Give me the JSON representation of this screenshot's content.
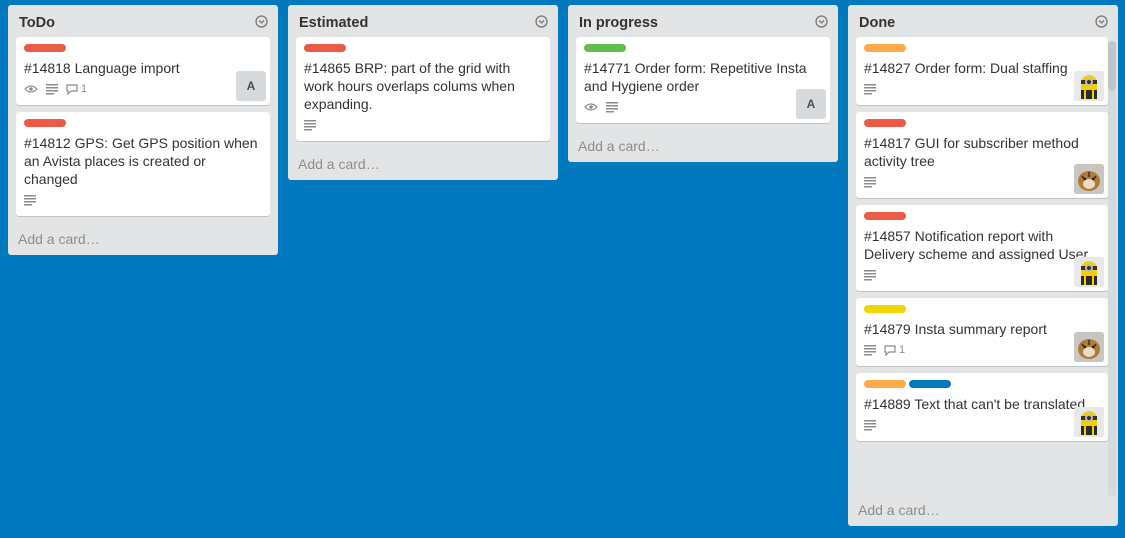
{
  "colors": {
    "background": "#0079bf",
    "red": "#eb5a46",
    "green": "#61bd4f",
    "orange": "#ffab4a",
    "yellow": "#f2d600",
    "blue": "#0079bf"
  },
  "lists": [
    {
      "title": "ToDo",
      "add_card": "Add a card…",
      "cards": [
        {
          "title": "#14818 Language import",
          "labels": [
            "red"
          ],
          "watch": true,
          "description": true,
          "comments": "1",
          "avatar": "A"
        },
        {
          "title": "#14812 GPS: Get GPS position when an Avista places is created or changed",
          "labels": [
            "red"
          ],
          "description": true
        }
      ]
    },
    {
      "title": "Estimated",
      "add_card": "Add a card…",
      "cards": [
        {
          "title": "#14865 BRP: part of the grid with work hours overlaps colums when expanding.",
          "labels": [
            "red"
          ],
          "description": true
        }
      ]
    },
    {
      "title": "In progress",
      "add_card": "Add a card…",
      "cards": [
        {
          "title": "#14771 Order form: Repetitive Insta and Hygiene order",
          "labels": [
            "green"
          ],
          "watch": true,
          "description": true,
          "avatar": "A"
        }
      ]
    },
    {
      "title": "Done",
      "add_card": "Add a card…",
      "cards": [
        {
          "title": "#14827 Order form: Dual staffing",
          "labels": [
            "orange"
          ],
          "description": true,
          "avatar_img": "minion-avatar-icon"
        },
        {
          "title": "#14817 GUI for subscriber method activity tree",
          "labels": [
            "red"
          ],
          "description": true,
          "avatar_img": "tiger-avatar-icon"
        },
        {
          "title": "#14857 Notification report with Delivery scheme and assigned User",
          "labels": [
            "red"
          ],
          "description": true,
          "avatar_img": "minion-avatar-icon"
        },
        {
          "title": "#14879 Insta summary report",
          "labels": [
            "yellow"
          ],
          "description": true,
          "comments": "1",
          "avatar_img": "tiger-avatar-icon"
        },
        {
          "title": "#14889 Text that can't be translated",
          "labels": [
            "orange",
            "blue"
          ],
          "description": true,
          "avatar_img": "minion-avatar-icon"
        }
      ]
    }
  ]
}
